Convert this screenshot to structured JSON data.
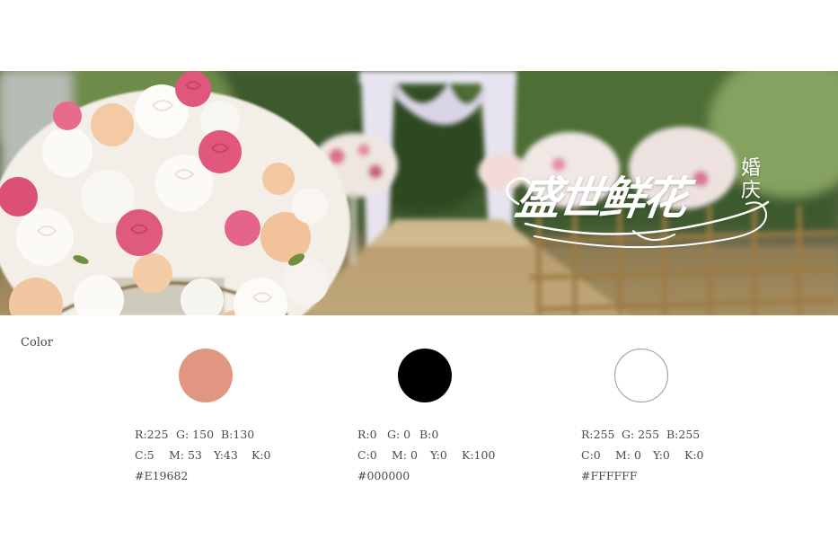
{
  "banner": {
    "logo_main": "盛世鲜花",
    "logo_side": "婚庆"
  },
  "section": {
    "label": "Color"
  },
  "swatches": [
    {
      "color": "#E19682",
      "rgb": {
        "r": "R:225",
        "g": "G: 150",
        "b": "B:130"
      },
      "cmyk": {
        "c": "C:5",
        "m": "M: 53",
        "y": "Y:43",
        "k": "K:0"
      },
      "hex": "#E19682"
    },
    {
      "color": "#000000",
      "rgb": {
        "r": "R:0",
        "g": "G: 0",
        "b": "B:0"
      },
      "cmyk": {
        "c": "C:0",
        "m": "M: 0",
        "y": "Y:0",
        "k": "K:100"
      },
      "hex": "#000000"
    },
    {
      "color": "#FFFFFF",
      "rgb": {
        "r": "R:255",
        "g": "G: 255",
        "b": "B:255"
      },
      "cmyk": {
        "c": "C:0",
        "m": "M: 0",
        "y": "Y:0",
        "k": "K:0"
      },
      "hex": "#FFFFFF"
    }
  ]
}
